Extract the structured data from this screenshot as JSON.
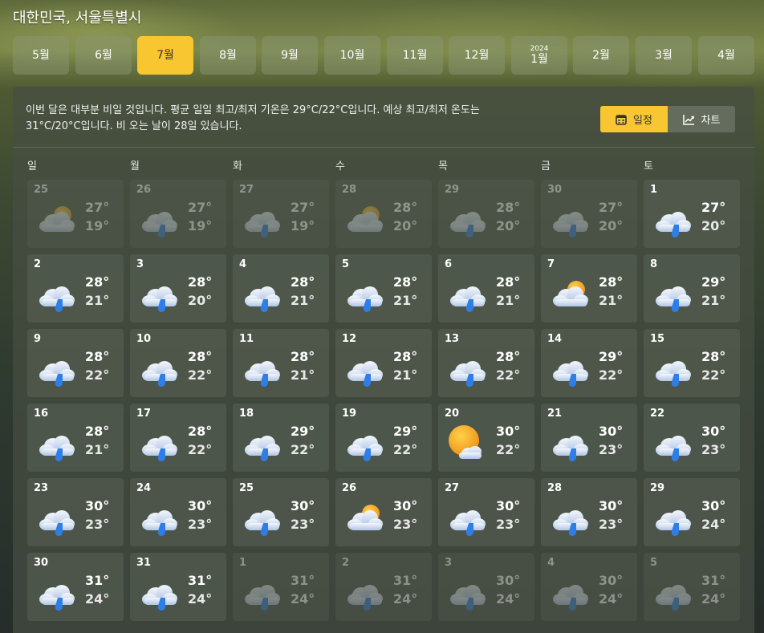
{
  "location": "대한민국, 서울특별시",
  "months": [
    {
      "label": "5월",
      "year": "",
      "active": false
    },
    {
      "label": "6월",
      "year": "",
      "active": false
    },
    {
      "label": "7월",
      "year": "",
      "active": true
    },
    {
      "label": "8월",
      "year": "",
      "active": false
    },
    {
      "label": "9월",
      "year": "",
      "active": false
    },
    {
      "label": "10월",
      "year": "",
      "active": false
    },
    {
      "label": "11월",
      "year": "",
      "active": false
    },
    {
      "label": "12월",
      "year": "",
      "active": false
    },
    {
      "label": "1월",
      "year": "2024",
      "active": false
    },
    {
      "label": "2월",
      "year": "",
      "active": false
    },
    {
      "label": "3월",
      "year": "",
      "active": false
    },
    {
      "label": "4월",
      "year": "",
      "active": false
    }
  ],
  "summary": "이번 달은 대부분 비일 것입니다. 평균 일일 최고/최저 기온은 29°C/22°C입니다. 예상 최고/최저 온도는 31°C/20°C입니다. 비 오는 날이 28일 있습니다.",
  "view_toggle": {
    "calendar_label": "일정",
    "chart_label": "차트",
    "selected": "calendar"
  },
  "weekdays": [
    "일",
    "월",
    "화",
    "수",
    "목",
    "금",
    "토"
  ],
  "icons": {
    "calendar": "calendar-icon",
    "chart": "trend-chart-icon",
    "rain": "rain-cloud-icon",
    "partly": "partly-cloudy-icon",
    "sunny": "sun-cloud-icon"
  },
  "colors": {
    "accent": "#f7c631",
    "rain": "#2f7ee8",
    "sun": "#f2a622"
  },
  "days": [
    {
      "d": "25",
      "hi": "27°",
      "lo": "19°",
      "icon": "partly",
      "dim": true
    },
    {
      "d": "26",
      "hi": "27°",
      "lo": "19°",
      "icon": "rain",
      "dim": true
    },
    {
      "d": "27",
      "hi": "27°",
      "lo": "19°",
      "icon": "rain",
      "dim": true
    },
    {
      "d": "28",
      "hi": "28°",
      "lo": "20°",
      "icon": "partly",
      "dim": true
    },
    {
      "d": "29",
      "hi": "28°",
      "lo": "20°",
      "icon": "rain",
      "dim": true
    },
    {
      "d": "30",
      "hi": "27°",
      "lo": "20°",
      "icon": "rain",
      "dim": true
    },
    {
      "d": "1",
      "hi": "27°",
      "lo": "20°",
      "icon": "rain",
      "dim": false
    },
    {
      "d": "2",
      "hi": "28°",
      "lo": "21°",
      "icon": "rain",
      "dim": false
    },
    {
      "d": "3",
      "hi": "28°",
      "lo": "20°",
      "icon": "rain",
      "dim": false
    },
    {
      "d": "4",
      "hi": "28°",
      "lo": "21°",
      "icon": "rain",
      "dim": false
    },
    {
      "d": "5",
      "hi": "28°",
      "lo": "21°",
      "icon": "rain",
      "dim": false
    },
    {
      "d": "6",
      "hi": "28°",
      "lo": "21°",
      "icon": "rain",
      "dim": false
    },
    {
      "d": "7",
      "hi": "28°",
      "lo": "21°",
      "icon": "partly",
      "dim": false
    },
    {
      "d": "8",
      "hi": "29°",
      "lo": "21°",
      "icon": "rain",
      "dim": false
    },
    {
      "d": "9",
      "hi": "28°",
      "lo": "22°",
      "icon": "rain",
      "dim": false
    },
    {
      "d": "10",
      "hi": "28°",
      "lo": "22°",
      "icon": "rain",
      "dim": false
    },
    {
      "d": "11",
      "hi": "28°",
      "lo": "21°",
      "icon": "rain",
      "dim": false
    },
    {
      "d": "12",
      "hi": "28°",
      "lo": "21°",
      "icon": "rain",
      "dim": false
    },
    {
      "d": "13",
      "hi": "28°",
      "lo": "22°",
      "icon": "rain",
      "dim": false
    },
    {
      "d": "14",
      "hi": "29°",
      "lo": "22°",
      "icon": "rain",
      "dim": false
    },
    {
      "d": "15",
      "hi": "28°",
      "lo": "22°",
      "icon": "rain",
      "dim": false
    },
    {
      "d": "16",
      "hi": "28°",
      "lo": "21°",
      "icon": "rain",
      "dim": false
    },
    {
      "d": "17",
      "hi": "28°",
      "lo": "22°",
      "icon": "rain",
      "dim": false
    },
    {
      "d": "18",
      "hi": "29°",
      "lo": "22°",
      "icon": "rain",
      "dim": false
    },
    {
      "d": "19",
      "hi": "29°",
      "lo": "22°",
      "icon": "rain",
      "dim": false
    },
    {
      "d": "20",
      "hi": "30°",
      "lo": "22°",
      "icon": "sunny",
      "dim": false
    },
    {
      "d": "21",
      "hi": "30°",
      "lo": "23°",
      "icon": "rain",
      "dim": false
    },
    {
      "d": "22",
      "hi": "30°",
      "lo": "23°",
      "icon": "rain",
      "dim": false
    },
    {
      "d": "23",
      "hi": "30°",
      "lo": "23°",
      "icon": "rain",
      "dim": false
    },
    {
      "d": "24",
      "hi": "30°",
      "lo": "23°",
      "icon": "rain",
      "dim": false
    },
    {
      "d": "25",
      "hi": "30°",
      "lo": "23°",
      "icon": "rain",
      "dim": false
    },
    {
      "d": "26",
      "hi": "30°",
      "lo": "23°",
      "icon": "partly",
      "dim": false
    },
    {
      "d": "27",
      "hi": "30°",
      "lo": "23°",
      "icon": "rain",
      "dim": false
    },
    {
      "d": "28",
      "hi": "30°",
      "lo": "23°",
      "icon": "rain",
      "dim": false
    },
    {
      "d": "29",
      "hi": "30°",
      "lo": "24°",
      "icon": "rain",
      "dim": false
    },
    {
      "d": "30",
      "hi": "31°",
      "lo": "24°",
      "icon": "rain",
      "dim": false
    },
    {
      "d": "31",
      "hi": "31°",
      "lo": "24°",
      "icon": "rain",
      "dim": false
    },
    {
      "d": "1",
      "hi": "31°",
      "lo": "24°",
      "icon": "rain",
      "dim": true
    },
    {
      "d": "2",
      "hi": "31°",
      "lo": "24°",
      "icon": "rain",
      "dim": true
    },
    {
      "d": "3",
      "hi": "30°",
      "lo": "24°",
      "icon": "rain",
      "dim": true
    },
    {
      "d": "4",
      "hi": "30°",
      "lo": "24°",
      "icon": "rain",
      "dim": true
    },
    {
      "d": "5",
      "hi": "31°",
      "lo": "24°",
      "icon": "rain",
      "dim": true
    }
  ]
}
